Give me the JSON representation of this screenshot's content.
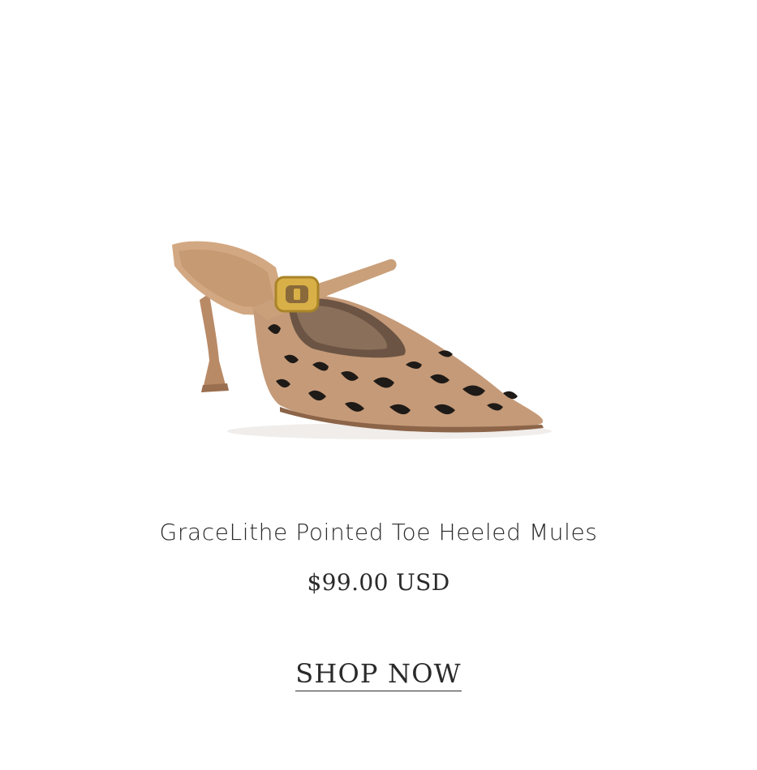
{
  "product": {
    "name": "GraceLithe Pointed Toe Heeled Mules",
    "price": "$99.00 USD",
    "image_alt": "Leopard knit pointed toe mule with tan leather strap and gold buckle"
  },
  "cta": {
    "label": "SHOP NOW"
  },
  "colors": {
    "background": "#ffffff",
    "text": "#2a2a2a",
    "tan": "#c9a07a",
    "leopard_base": "#c59a78",
    "leopard_spot": "#1e1a17",
    "buckle_gold": "#d9b048"
  }
}
